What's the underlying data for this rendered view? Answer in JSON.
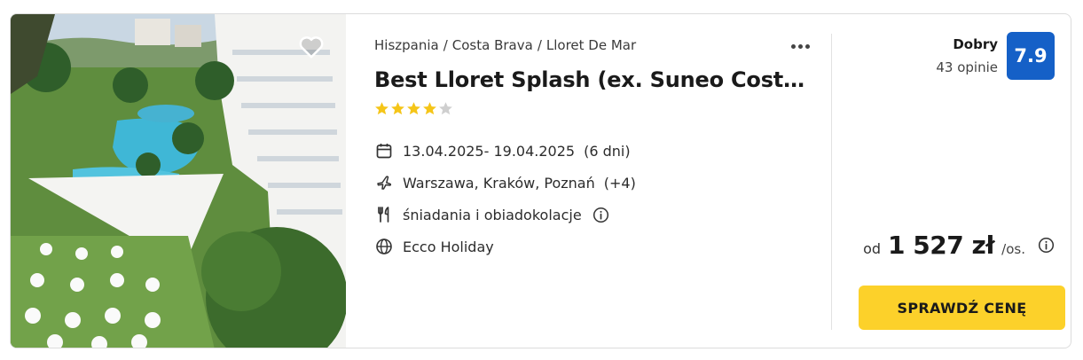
{
  "offer": {
    "breadcrumb": [
      "Hiszpania",
      "Costa Brava",
      "Lloret De Mar"
    ],
    "breadcrumb_separator": "/",
    "title": "Best Lloret Splash (ex. Suneo Costa Brava)",
    "stars": {
      "rating": 4,
      "max": 5,
      "filled_color": "#f5c518",
      "empty_color": "#cfcfcf"
    },
    "dates": "13.04.2025- 19.04.2025",
    "duration": "(6 dni)",
    "departures": "Warszawa, Kraków, Poznań",
    "departures_more": "(+4)",
    "board": "śniadania i obiadokolacje",
    "operator": "Ecco Holiday"
  },
  "rating": {
    "label": "Dobry",
    "reviews": "43 opinie",
    "score": "7.9",
    "color": "#1560c7"
  },
  "price": {
    "prefix": "od",
    "amount": "1 527 zł",
    "suffix": "/os."
  },
  "cta": {
    "label": "SPRAWDŹ CENĘ",
    "color": "#fcd12a"
  },
  "icons": {
    "favorite": "heart-icon",
    "more": "more-dots-icon",
    "dates": "calendar-icon",
    "departures": "airplane-icon",
    "board": "cutlery-icon",
    "board_info": "info-icon",
    "operator": "globe-icon",
    "price_info": "info-icon"
  }
}
